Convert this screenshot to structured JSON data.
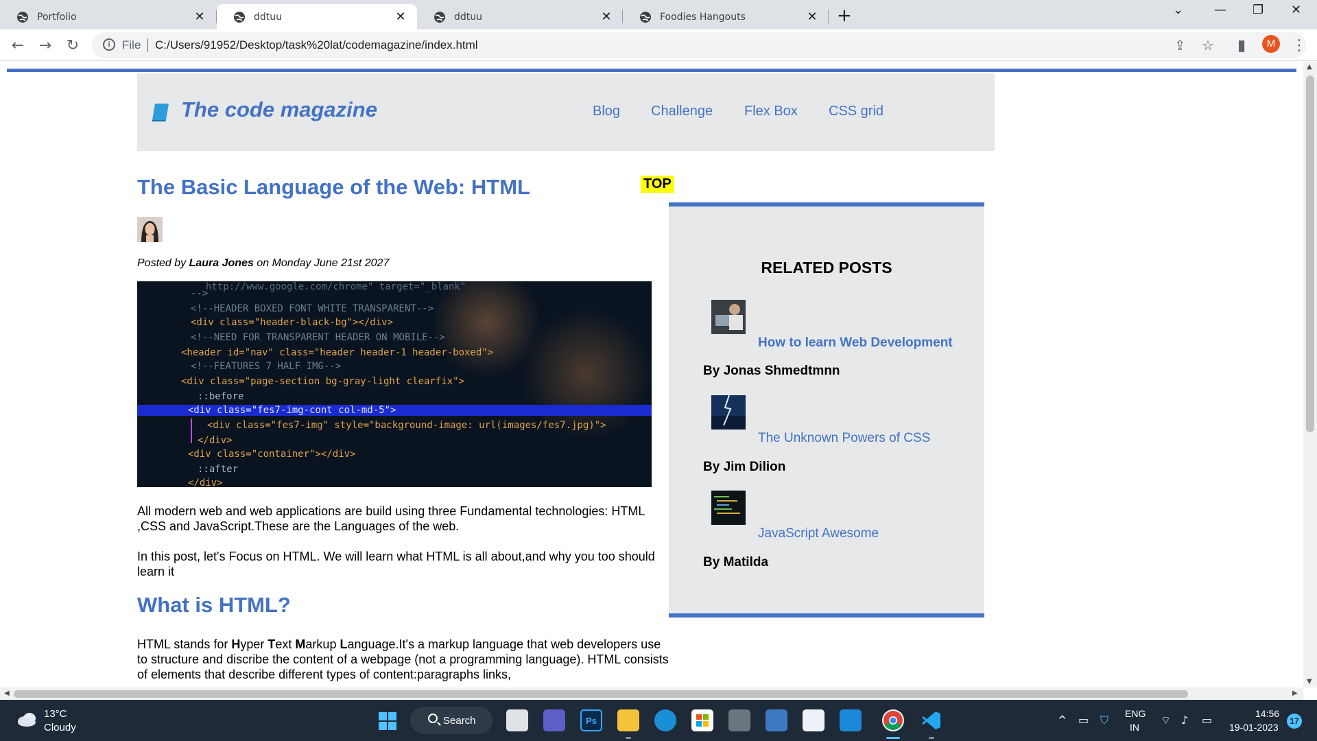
{
  "browser": {
    "tabs": [
      {
        "label": "Portfolio"
      },
      {
        "label": "ddtuu"
      },
      {
        "label": "ddtuu"
      },
      {
        "label": "Foodies Hangouts"
      }
    ],
    "new_tab": "+",
    "address": {
      "scheme_label": "File",
      "url": "C:/Users/91952/Desktop/task%20lat/codemagazine/index.html"
    },
    "profile_initial": "M"
  },
  "site": {
    "logo_text": "The code magazine",
    "nav": [
      "Blog",
      "Challenge",
      "Flex Box",
      "CSS grid"
    ]
  },
  "article": {
    "title": "The Basic Language of the Web: HTML",
    "top_badge": "TOP",
    "byline_prefix": "Posted by ",
    "author": "Laura Jones",
    "byline_suffix": " on Monday June 21st 2027",
    "para1": "All modern web and web applications are build using three Fundamental technologies: HTML ,CSS and JavaScript.These are the Languages of the web.",
    "para2": "In this post, let's Focus on HTML. We will learn what HTML is all about,and why you too should learn it",
    "subheading": "What is HTML?",
    "para3_parts": {
      "a": "HTML stands for ",
      "b1": "H",
      "c1": "yper ",
      "b2": "T",
      "c2": "ext ",
      "b3": "M",
      "c3": "arkup ",
      "b4": "L",
      "c4": "anguage.It's a markup language that web developers use to structure and discribe the content of a webpage (not a programming language). HTML consists of elements that describe different types of content:paragraphs links,"
    },
    "hero_code": [
      "http://www.google.com/chrome\" target=\"_blank\"",
      "-->",
      "<!--HEADER BOXED FONT WHITE TRANSPARENT-->",
      "<div class=\"header-black-bg\"></div>",
      "<!--NEED FOR TRANSPARENT HEADER ON MOBILE-->",
      "<header id=\"nav\" class=\"header header-1 header-boxed\">",
      "<!--FEATURES 7 HALF IMG-->",
      "<div class=\"page-section bg-gray-light clearfix\">",
      "::before",
      "<div class=\"fes7-img-cont col-md-5\">",
      "<div class=\"fes7-img\" style=\"background-image: url(images/fes7.jpg)\">",
      "</div>",
      "<div class=\"container\"></div>",
      "::after",
      "</div>"
    ]
  },
  "related": {
    "heading": "RELATED POSTS",
    "posts": [
      {
        "title": "How to learn Web Development",
        "author": "By Jonas Shmedtmnn"
      },
      {
        "title": "The Unknown Powers of CSS",
        "author": "By Jim Dilion"
      },
      {
        "title": "JavaScript Awesome",
        "author": "By Matilda"
      }
    ]
  },
  "taskbar": {
    "weather_temp": "13°C",
    "weather_cond": "Cloudy",
    "search_label": "Search",
    "lang1": "ENG",
    "lang2": "IN",
    "time": "14:56",
    "date": "19-01-2023",
    "notification_count": "17"
  },
  "colors": {
    "accent": "#4472c4",
    "header_bg": "#e6e8ea",
    "highlight": "#ffff00"
  }
}
